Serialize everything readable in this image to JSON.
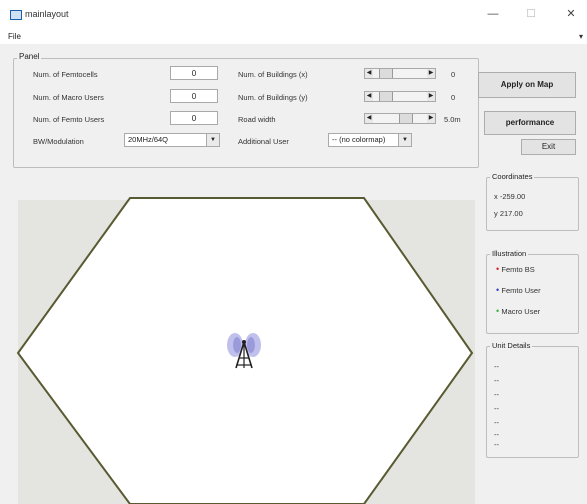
{
  "window": {
    "title": "mainlayout",
    "minimize": "—",
    "maximize": "☐",
    "close": "✕"
  },
  "menu": {
    "file": "File",
    "more": "▾"
  },
  "panel": {
    "title": "Panel",
    "femtocells_label": "Num. of Femtocells",
    "femtocells_value": "0",
    "macro_users_label": "Num. of Macro Users",
    "macro_users_value": "0",
    "femto_users_label": "Num. of Femto Users",
    "femto_users_value": "0",
    "bw_label": "BW/Modulation",
    "bw_value": "20MHz/64Q",
    "buildings_x_label": "Num. of Buildings (x)",
    "buildings_x_value": "0",
    "buildings_y_label": "Num. of Buildings (y)",
    "buildings_y_value": "0",
    "road_label": "Road width",
    "road_value": "5.0m",
    "additional_user_label": "Additional User",
    "additional_user_value": "-- (no colormap)",
    "apply_button": "Apply on Map",
    "performance_button": "performance",
    "exit_button": "Exit"
  },
  "coordinates": {
    "title": "Coordinates",
    "x": "x -259.00",
    "y": "y 217.00"
  },
  "illustration": {
    "title": "Illustration",
    "items": [
      {
        "label": "Femto BS",
        "color": "#d9232a"
      },
      {
        "label": "Femto User",
        "color": "#3a3ac8"
      },
      {
        "label": "Macro User",
        "color": "#3cb043"
      }
    ]
  },
  "unit_details": {
    "title": "Unit Details",
    "lines": [
      "--",
      "--",
      "--",
      "--",
      "--",
      "--",
      "--"
    ]
  },
  "map": {
    "antenna_icon": "cell-tower-icon",
    "hexagon_stroke": "#5a5a32"
  }
}
